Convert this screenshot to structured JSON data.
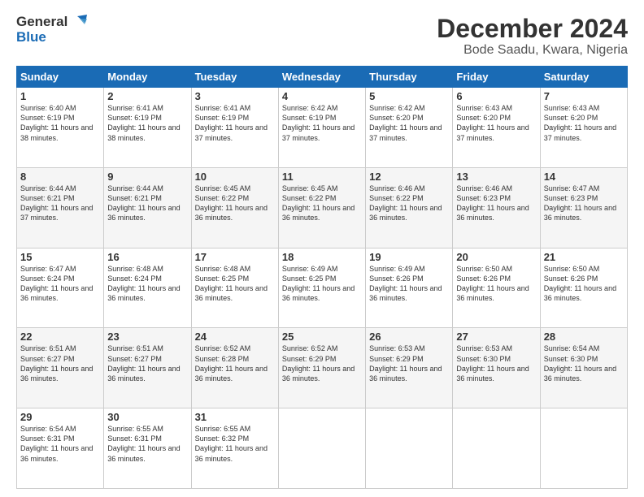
{
  "logo": {
    "line1": "General",
    "line2": "Blue"
  },
  "title": "December 2024",
  "subtitle": "Bode Saadu, Kwara, Nigeria",
  "days_of_week": [
    "Sunday",
    "Monday",
    "Tuesday",
    "Wednesday",
    "Thursday",
    "Friday",
    "Saturday"
  ],
  "weeks": [
    [
      {
        "day": "1",
        "sunrise": "6:40 AM",
        "sunset": "6:19 PM",
        "daylight": "11 hours and 38 minutes."
      },
      {
        "day": "2",
        "sunrise": "6:41 AM",
        "sunset": "6:19 PM",
        "daylight": "11 hours and 38 minutes."
      },
      {
        "day": "3",
        "sunrise": "6:41 AM",
        "sunset": "6:19 PM",
        "daylight": "11 hours and 37 minutes."
      },
      {
        "day": "4",
        "sunrise": "6:42 AM",
        "sunset": "6:19 PM",
        "daylight": "11 hours and 37 minutes."
      },
      {
        "day": "5",
        "sunrise": "6:42 AM",
        "sunset": "6:20 PM",
        "daylight": "11 hours and 37 minutes."
      },
      {
        "day": "6",
        "sunrise": "6:43 AM",
        "sunset": "6:20 PM",
        "daylight": "11 hours and 37 minutes."
      },
      {
        "day": "7",
        "sunrise": "6:43 AM",
        "sunset": "6:20 PM",
        "daylight": "11 hours and 37 minutes."
      }
    ],
    [
      {
        "day": "8",
        "sunrise": "6:44 AM",
        "sunset": "6:21 PM",
        "daylight": "11 hours and 37 minutes."
      },
      {
        "day": "9",
        "sunrise": "6:44 AM",
        "sunset": "6:21 PM",
        "daylight": "11 hours and 36 minutes."
      },
      {
        "day": "10",
        "sunrise": "6:45 AM",
        "sunset": "6:22 PM",
        "daylight": "11 hours and 36 minutes."
      },
      {
        "day": "11",
        "sunrise": "6:45 AM",
        "sunset": "6:22 PM",
        "daylight": "11 hours and 36 minutes."
      },
      {
        "day": "12",
        "sunrise": "6:46 AM",
        "sunset": "6:22 PM",
        "daylight": "11 hours and 36 minutes."
      },
      {
        "day": "13",
        "sunrise": "6:46 AM",
        "sunset": "6:23 PM",
        "daylight": "11 hours and 36 minutes."
      },
      {
        "day": "14",
        "sunrise": "6:47 AM",
        "sunset": "6:23 PM",
        "daylight": "11 hours and 36 minutes."
      }
    ],
    [
      {
        "day": "15",
        "sunrise": "6:47 AM",
        "sunset": "6:24 PM",
        "daylight": "11 hours and 36 minutes."
      },
      {
        "day": "16",
        "sunrise": "6:48 AM",
        "sunset": "6:24 PM",
        "daylight": "11 hours and 36 minutes."
      },
      {
        "day": "17",
        "sunrise": "6:48 AM",
        "sunset": "6:25 PM",
        "daylight": "11 hours and 36 minutes."
      },
      {
        "day": "18",
        "sunrise": "6:49 AM",
        "sunset": "6:25 PM",
        "daylight": "11 hours and 36 minutes."
      },
      {
        "day": "19",
        "sunrise": "6:49 AM",
        "sunset": "6:26 PM",
        "daylight": "11 hours and 36 minutes."
      },
      {
        "day": "20",
        "sunrise": "6:50 AM",
        "sunset": "6:26 PM",
        "daylight": "11 hours and 36 minutes."
      },
      {
        "day": "21",
        "sunrise": "6:50 AM",
        "sunset": "6:26 PM",
        "daylight": "11 hours and 36 minutes."
      }
    ],
    [
      {
        "day": "22",
        "sunrise": "6:51 AM",
        "sunset": "6:27 PM",
        "daylight": "11 hours and 36 minutes."
      },
      {
        "day": "23",
        "sunrise": "6:51 AM",
        "sunset": "6:27 PM",
        "daylight": "11 hours and 36 minutes."
      },
      {
        "day": "24",
        "sunrise": "6:52 AM",
        "sunset": "6:28 PM",
        "daylight": "11 hours and 36 minutes."
      },
      {
        "day": "25",
        "sunrise": "6:52 AM",
        "sunset": "6:29 PM",
        "daylight": "11 hours and 36 minutes."
      },
      {
        "day": "26",
        "sunrise": "6:53 AM",
        "sunset": "6:29 PM",
        "daylight": "11 hours and 36 minutes."
      },
      {
        "day": "27",
        "sunrise": "6:53 AM",
        "sunset": "6:30 PM",
        "daylight": "11 hours and 36 minutes."
      },
      {
        "day": "28",
        "sunrise": "6:54 AM",
        "sunset": "6:30 PM",
        "daylight": "11 hours and 36 minutes."
      }
    ],
    [
      {
        "day": "29",
        "sunrise": "6:54 AM",
        "sunset": "6:31 PM",
        "daylight": "11 hours and 36 minutes."
      },
      {
        "day": "30",
        "sunrise": "6:55 AM",
        "sunset": "6:31 PM",
        "daylight": "11 hours and 36 minutes."
      },
      {
        "day": "31",
        "sunrise": "6:55 AM",
        "sunset": "6:32 PM",
        "daylight": "11 hours and 36 minutes."
      },
      null,
      null,
      null,
      null
    ]
  ]
}
